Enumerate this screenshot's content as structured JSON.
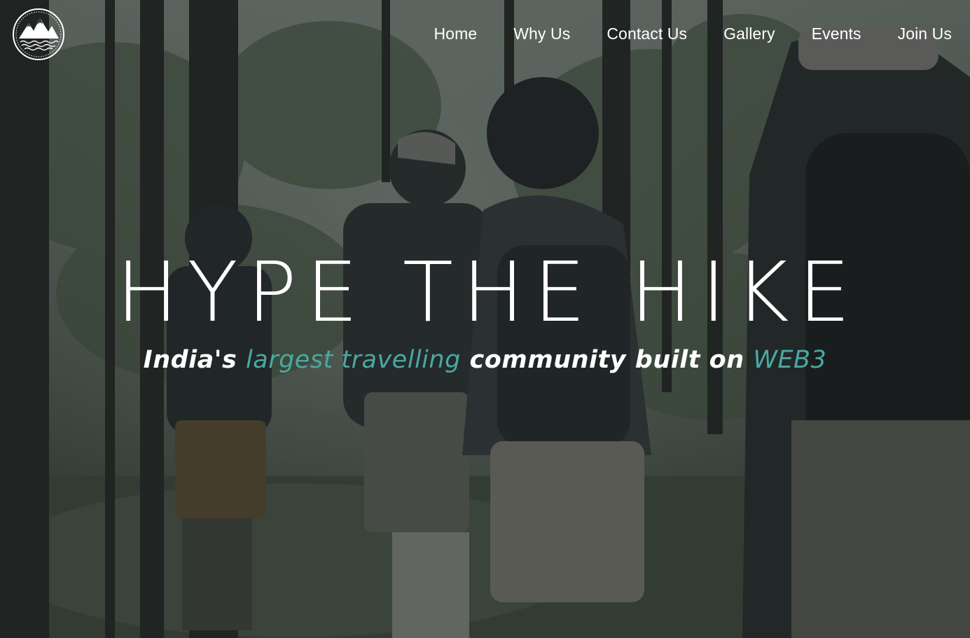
{
  "brand": {
    "logo_icon": "mountain-waves-logo-icon"
  },
  "nav": {
    "items": [
      {
        "label": "Home"
      },
      {
        "label": "Why Us"
      },
      {
        "label": "Contact Us"
      },
      {
        "label": "Gallery"
      },
      {
        "label": "Events"
      },
      {
        "label": "Join Us"
      }
    ]
  },
  "hero": {
    "headline": "HYPE THE HIKE",
    "tagline": {
      "part1": "India's ",
      "part2": "largest travelling",
      "part3": " community built on ",
      "part4": "WEB3"
    },
    "background": "hikers-in-forest-photo",
    "accent_color": "#4aa9a2"
  }
}
